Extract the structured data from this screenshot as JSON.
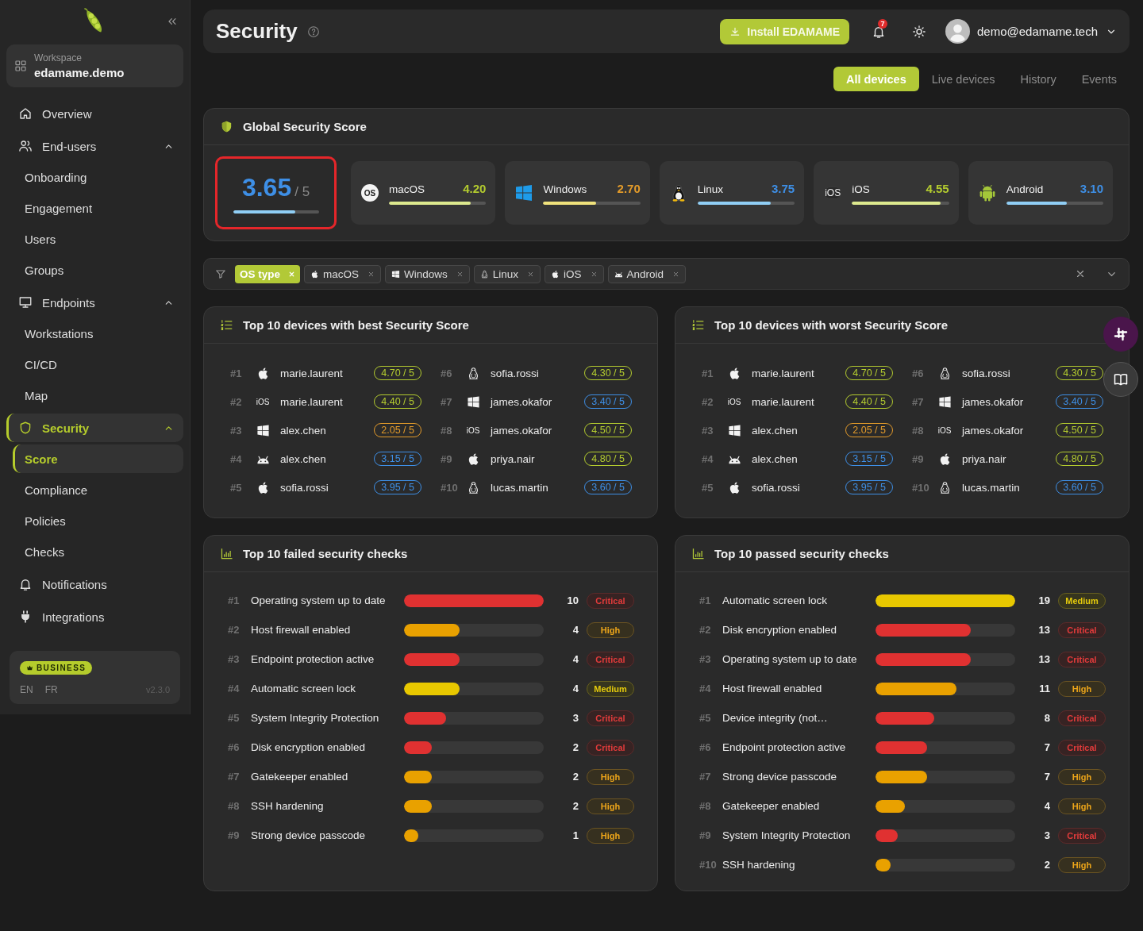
{
  "sidebar": {
    "workspace": {
      "label": "Workspace",
      "name": "edamame.demo"
    },
    "nav": [
      {
        "label": "Overview",
        "selected": false
      },
      {
        "label": "End-users",
        "selected": false,
        "expanded": true,
        "children": [
          {
            "label": "Onboarding",
            "selected": false
          },
          {
            "label": "Engagement",
            "selected": false
          },
          {
            "label": "Users",
            "selected": false
          },
          {
            "label": "Groups",
            "selected": false
          }
        ]
      },
      {
        "label": "Endpoints",
        "selected": false,
        "expanded": true,
        "children": [
          {
            "label": "Workstations",
            "selected": false
          },
          {
            "label": "CI/CD",
            "selected": false
          },
          {
            "label": "Map",
            "selected": false
          }
        ]
      },
      {
        "label": "Security",
        "selected": true,
        "expanded": true,
        "children": [
          {
            "label": "Score",
            "selected": true
          },
          {
            "label": "Compliance",
            "selected": false
          },
          {
            "label": "Policies",
            "selected": false
          },
          {
            "label": "Checks",
            "selected": false
          }
        ]
      },
      {
        "label": "Notifications",
        "selected": false
      },
      {
        "label": "Integrations",
        "selected": false
      }
    ],
    "plan": {
      "badge": "BUSINESS",
      "languages": [
        "EN",
        "FR"
      ],
      "version": "v2.3.0"
    }
  },
  "header": {
    "title": "Security",
    "install_button": "Install EDAMAME",
    "notification_count": "7",
    "user_email": "demo@edamame.tech"
  },
  "tabs": [
    {
      "label": "All devices",
      "selected": true
    },
    {
      "label": "Live devices",
      "selected": false
    },
    {
      "label": "History",
      "selected": false
    },
    {
      "label": "Events",
      "selected": false
    }
  ],
  "global_score": {
    "title": "Global Security Score",
    "score": "3.65",
    "max": "/ 5",
    "color": "#3e8fe6",
    "bar": {
      "level": 0.73,
      "color": "#90cef5"
    },
    "highlighted": true,
    "os_scores": [
      {
        "kind": "macos",
        "icon_text": "OS",
        "name": "macOS",
        "score": "4.20",
        "color": "#b3cb2f",
        "bar": {
          "level": 0.84,
          "color": "#dde98e"
        }
      },
      {
        "kind": "windows",
        "name": "Windows",
        "score": "2.70",
        "color": "#e39b2a",
        "bar": {
          "level": 0.54,
          "color": "#f0e27c"
        }
      },
      {
        "kind": "linux",
        "name": "Linux",
        "score": "3.75",
        "color": "#3e8fe6",
        "bar": {
          "level": 0.75,
          "color": "#90cef5"
        }
      },
      {
        "kind": "ios",
        "icon_text": "iOS",
        "name": "iOS",
        "score": "4.55",
        "color": "#b3cb2f",
        "bar": {
          "level": 0.91,
          "color": "#dde98e"
        }
      },
      {
        "kind": "android",
        "name": "Android",
        "score": "3.10",
        "color": "#3e8fe6",
        "bar": {
          "level": 0.62,
          "color": "#90cef5"
        }
      }
    ]
  },
  "filter": {
    "field": "OS type",
    "values": [
      {
        "kind": "macos",
        "label": "macOS"
      },
      {
        "kind": "windows",
        "label": "Windows"
      },
      {
        "kind": "linux",
        "label": "Linux"
      },
      {
        "kind": "ios",
        "label": "iOS"
      },
      {
        "kind": "android",
        "label": "Android"
      }
    ]
  },
  "device_rankings": [
    {
      "title": "Top 10 devices with best Security Score",
      "devices": [
        {
          "rank": "#1",
          "kind": "macos",
          "user": "marie.laurent",
          "score": "4.70 / 5",
          "color": "#b3cb2f"
        },
        {
          "rank": "#2",
          "kind": "ios",
          "icon_text": "iOS",
          "user": "marie.laurent",
          "score": "4.40 / 5",
          "color": "#b3cb2f"
        },
        {
          "rank": "#3",
          "kind": "windows",
          "user": "alex.chen",
          "score": "2.05 / 5",
          "color": "#e39b2a"
        },
        {
          "rank": "#4",
          "kind": "android",
          "user": "alex.chen",
          "score": "3.15 / 5",
          "color": "#3e8fe6"
        },
        {
          "rank": "#5",
          "kind": "macos",
          "user": "sofia.rossi",
          "score": "3.95 / 5",
          "color": "#3e8fe6"
        },
        {
          "rank": "#6",
          "kind": "linux",
          "user": "sofia.rossi",
          "score": "4.30 / 5",
          "color": "#b3cb2f"
        },
        {
          "rank": "#7",
          "kind": "windows",
          "user": "james.okafor",
          "score": "3.40 / 5",
          "color": "#3e8fe6"
        },
        {
          "rank": "#8",
          "kind": "ios",
          "icon_text": "iOS",
          "user": "james.okafor",
          "score": "4.50 / 5",
          "color": "#b3cb2f"
        },
        {
          "rank": "#9",
          "kind": "macos",
          "user": "priya.nair",
          "score": "4.80 / 5",
          "color": "#b3cb2f"
        },
        {
          "rank": "#10",
          "kind": "linux",
          "user": "lucas.martin",
          "score": "3.60 / 5",
          "color": "#3e8fe6"
        }
      ]
    },
    {
      "title": "Top 10 devices with worst Security Score",
      "devices": [
        {
          "rank": "#1",
          "kind": "macos",
          "user": "marie.laurent",
          "score": "4.70 / 5",
          "color": "#b3cb2f"
        },
        {
          "rank": "#2",
          "kind": "ios",
          "icon_text": "iOS",
          "user": "marie.laurent",
          "score": "4.40 / 5",
          "color": "#b3cb2f"
        },
        {
          "rank": "#3",
          "kind": "windows",
          "user": "alex.chen",
          "score": "2.05 / 5",
          "color": "#e39b2a"
        },
        {
          "rank": "#4",
          "kind": "android",
          "user": "alex.chen",
          "score": "3.15 / 5",
          "color": "#3e8fe6"
        },
        {
          "rank": "#5",
          "kind": "macos",
          "user": "sofia.rossi",
          "score": "3.95 / 5",
          "color": "#3e8fe6"
        },
        {
          "rank": "#6",
          "kind": "linux",
          "user": "sofia.rossi",
          "score": "4.30 / 5",
          "color": "#b3cb2f"
        },
        {
          "rank": "#7",
          "kind": "windows",
          "user": "james.okafor",
          "score": "3.40 / 5",
          "color": "#3e8fe6"
        },
        {
          "rank": "#8",
          "kind": "ios",
          "icon_text": "iOS",
          "user": "james.okafor",
          "score": "4.50 / 5",
          "color": "#b3cb2f"
        },
        {
          "rank": "#9",
          "kind": "macos",
          "user": "priya.nair",
          "score": "4.80 / 5",
          "color": "#b3cb2f"
        },
        {
          "rank": "#10",
          "kind": "linux",
          "user": "lucas.martin",
          "score": "3.60 / 5",
          "color": "#3e8fe6"
        }
      ]
    }
  ],
  "check_rankings": [
    {
      "title": "Top 10 failed security checks",
      "checks": [
        {
          "rank": "#1",
          "name": "Operating system up to date",
          "level": 1,
          "count": "10",
          "severity": "Critical",
          "kind": "critical"
        },
        {
          "rank": "#2",
          "name": "Host firewall enabled",
          "level": 0.4,
          "count": "4",
          "severity": "High",
          "kind": "high"
        },
        {
          "rank": "#3",
          "name": "Endpoint protection active",
          "level": 0.4,
          "count": "4",
          "severity": "Critical",
          "kind": "critical"
        },
        {
          "rank": "#4",
          "name": "Automatic screen lock",
          "level": 0.4,
          "count": "4",
          "severity": "Medium",
          "kind": "medium"
        },
        {
          "rank": "#5",
          "name": "System Integrity Protection",
          "level": 0.3,
          "count": "3",
          "severity": "Critical",
          "kind": "critical"
        },
        {
          "rank": "#6",
          "name": "Disk encryption enabled",
          "level": 0.2,
          "count": "2",
          "severity": "Critical",
          "kind": "critical"
        },
        {
          "rank": "#7",
          "name": "Gatekeeper enabled",
          "level": 0.2,
          "count": "2",
          "severity": "High",
          "kind": "high"
        },
        {
          "rank": "#8",
          "name": "SSH hardening",
          "level": 0.2,
          "count": "2",
          "severity": "High",
          "kind": "high"
        },
        {
          "rank": "#9",
          "name": "Strong device passcode",
          "level": 0.1,
          "count": "1",
          "severity": "High",
          "kind": "high"
        }
      ]
    },
    {
      "title": "Top 10 passed security checks",
      "checks": [
        {
          "rank": "#1",
          "name": "Automatic screen lock",
          "level": 1,
          "count": "19",
          "severity": "Medium",
          "kind": "medium"
        },
        {
          "rank": "#2",
          "name": "Disk encryption enabled",
          "level": 0.68,
          "count": "13",
          "severity": "Critical",
          "kind": "critical"
        },
        {
          "rank": "#3",
          "name": "Operating system up to date",
          "level": 0.68,
          "count": "13",
          "severity": "Critical",
          "kind": "critical"
        },
        {
          "rank": "#4",
          "name": "Host firewall enabled",
          "level": 0.58,
          "count": "11",
          "severity": "High",
          "kind": "high"
        },
        {
          "rank": "#5",
          "name": "Device integrity (not…",
          "level": 0.42,
          "count": "8",
          "severity": "Critical",
          "kind": "critical"
        },
        {
          "rank": "#6",
          "name": "Endpoint protection active",
          "level": 0.37,
          "count": "7",
          "severity": "Critical",
          "kind": "critical"
        },
        {
          "rank": "#7",
          "name": "Strong device passcode",
          "level": 0.37,
          "count": "7",
          "severity": "High",
          "kind": "high"
        },
        {
          "rank": "#8",
          "name": "Gatekeeper enabled",
          "level": 0.21,
          "count": "4",
          "severity": "High",
          "kind": "high"
        },
        {
          "rank": "#9",
          "name": "System Integrity Protection",
          "level": 0.16,
          "count": "3",
          "severity": "Critical",
          "kind": "critical"
        },
        {
          "rank": "#10",
          "name": "SSH hardening",
          "level": 0.11,
          "count": "2",
          "severity": "High",
          "kind": "high"
        }
      ]
    }
  ]
}
